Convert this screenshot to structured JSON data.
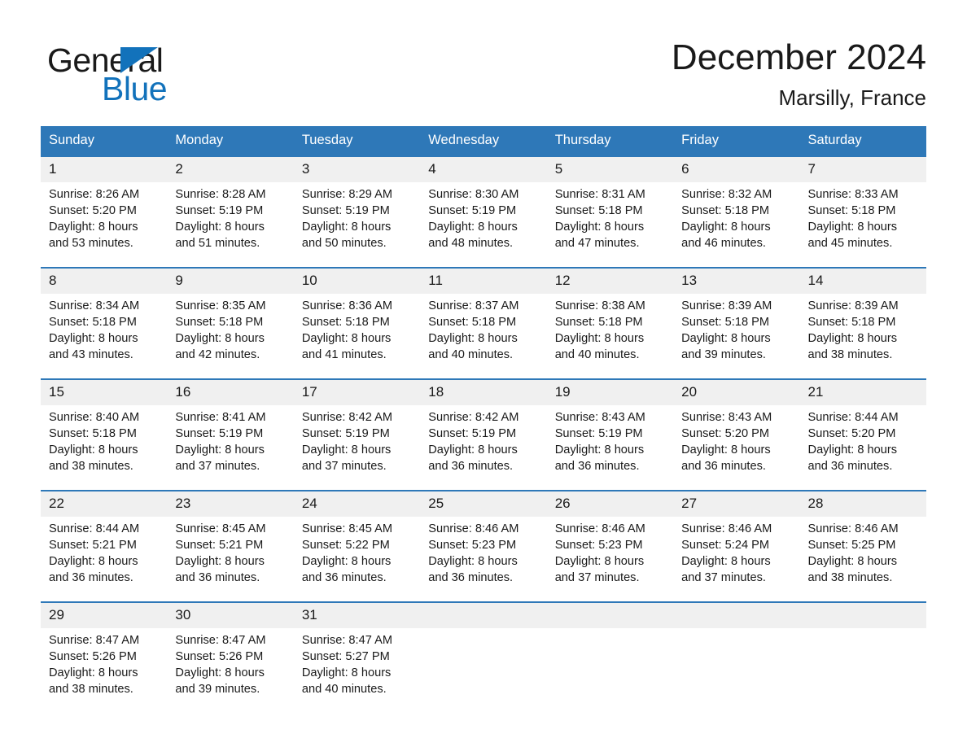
{
  "brand": {
    "name_part1": "General",
    "name_part2": "Blue",
    "triangle_color": "#1272bb",
    "logo_icon": "triangle-logo-icon"
  },
  "header": {
    "title": "December 2024",
    "location": "Marsilly, France"
  },
  "colors": {
    "header_row": "#2e78b8",
    "daynum_background": "#f0f0f0",
    "accent_rule": "#2e78b8",
    "text": "#1a1a1a"
  },
  "calendar": {
    "weekday_headers": [
      "Sunday",
      "Monday",
      "Tuesday",
      "Wednesday",
      "Thursday",
      "Friday",
      "Saturday"
    ],
    "weeks": [
      [
        {
          "day": "1",
          "sunrise": "Sunrise: 8:26 AM",
          "sunset": "Sunset: 5:20 PM",
          "daylight1": "Daylight: 8 hours",
          "daylight2": "and 53 minutes."
        },
        {
          "day": "2",
          "sunrise": "Sunrise: 8:28 AM",
          "sunset": "Sunset: 5:19 PM",
          "daylight1": "Daylight: 8 hours",
          "daylight2": "and 51 minutes."
        },
        {
          "day": "3",
          "sunrise": "Sunrise: 8:29 AM",
          "sunset": "Sunset: 5:19 PM",
          "daylight1": "Daylight: 8 hours",
          "daylight2": "and 50 minutes."
        },
        {
          "day": "4",
          "sunrise": "Sunrise: 8:30 AM",
          "sunset": "Sunset: 5:19 PM",
          "daylight1": "Daylight: 8 hours",
          "daylight2": "and 48 minutes."
        },
        {
          "day": "5",
          "sunrise": "Sunrise: 8:31 AM",
          "sunset": "Sunset: 5:18 PM",
          "daylight1": "Daylight: 8 hours",
          "daylight2": "and 47 minutes."
        },
        {
          "day": "6",
          "sunrise": "Sunrise: 8:32 AM",
          "sunset": "Sunset: 5:18 PM",
          "daylight1": "Daylight: 8 hours",
          "daylight2": "and 46 minutes."
        },
        {
          "day": "7",
          "sunrise": "Sunrise: 8:33 AM",
          "sunset": "Sunset: 5:18 PM",
          "daylight1": "Daylight: 8 hours",
          "daylight2": "and 45 minutes."
        }
      ],
      [
        {
          "day": "8",
          "sunrise": "Sunrise: 8:34 AM",
          "sunset": "Sunset: 5:18 PM",
          "daylight1": "Daylight: 8 hours",
          "daylight2": "and 43 minutes."
        },
        {
          "day": "9",
          "sunrise": "Sunrise: 8:35 AM",
          "sunset": "Sunset: 5:18 PM",
          "daylight1": "Daylight: 8 hours",
          "daylight2": "and 42 minutes."
        },
        {
          "day": "10",
          "sunrise": "Sunrise: 8:36 AM",
          "sunset": "Sunset: 5:18 PM",
          "daylight1": "Daylight: 8 hours",
          "daylight2": "and 41 minutes."
        },
        {
          "day": "11",
          "sunrise": "Sunrise: 8:37 AM",
          "sunset": "Sunset: 5:18 PM",
          "daylight1": "Daylight: 8 hours",
          "daylight2": "and 40 minutes."
        },
        {
          "day": "12",
          "sunrise": "Sunrise: 8:38 AM",
          "sunset": "Sunset: 5:18 PM",
          "daylight1": "Daylight: 8 hours",
          "daylight2": "and 40 minutes."
        },
        {
          "day": "13",
          "sunrise": "Sunrise: 8:39 AM",
          "sunset": "Sunset: 5:18 PM",
          "daylight1": "Daylight: 8 hours",
          "daylight2": "and 39 minutes."
        },
        {
          "day": "14",
          "sunrise": "Sunrise: 8:39 AM",
          "sunset": "Sunset: 5:18 PM",
          "daylight1": "Daylight: 8 hours",
          "daylight2": "and 38 minutes."
        }
      ],
      [
        {
          "day": "15",
          "sunrise": "Sunrise: 8:40 AM",
          "sunset": "Sunset: 5:18 PM",
          "daylight1": "Daylight: 8 hours",
          "daylight2": "and 38 minutes."
        },
        {
          "day": "16",
          "sunrise": "Sunrise: 8:41 AM",
          "sunset": "Sunset: 5:19 PM",
          "daylight1": "Daylight: 8 hours",
          "daylight2": "and 37 minutes."
        },
        {
          "day": "17",
          "sunrise": "Sunrise: 8:42 AM",
          "sunset": "Sunset: 5:19 PM",
          "daylight1": "Daylight: 8 hours",
          "daylight2": "and 37 minutes."
        },
        {
          "day": "18",
          "sunrise": "Sunrise: 8:42 AM",
          "sunset": "Sunset: 5:19 PM",
          "daylight1": "Daylight: 8 hours",
          "daylight2": "and 36 minutes."
        },
        {
          "day": "19",
          "sunrise": "Sunrise: 8:43 AM",
          "sunset": "Sunset: 5:19 PM",
          "daylight1": "Daylight: 8 hours",
          "daylight2": "and 36 minutes."
        },
        {
          "day": "20",
          "sunrise": "Sunrise: 8:43 AM",
          "sunset": "Sunset: 5:20 PM",
          "daylight1": "Daylight: 8 hours",
          "daylight2": "and 36 minutes."
        },
        {
          "day": "21",
          "sunrise": "Sunrise: 8:44 AM",
          "sunset": "Sunset: 5:20 PM",
          "daylight1": "Daylight: 8 hours",
          "daylight2": "and 36 minutes."
        }
      ],
      [
        {
          "day": "22",
          "sunrise": "Sunrise: 8:44 AM",
          "sunset": "Sunset: 5:21 PM",
          "daylight1": "Daylight: 8 hours",
          "daylight2": "and 36 minutes."
        },
        {
          "day": "23",
          "sunrise": "Sunrise: 8:45 AM",
          "sunset": "Sunset: 5:21 PM",
          "daylight1": "Daylight: 8 hours",
          "daylight2": "and 36 minutes."
        },
        {
          "day": "24",
          "sunrise": "Sunrise: 8:45 AM",
          "sunset": "Sunset: 5:22 PM",
          "daylight1": "Daylight: 8 hours",
          "daylight2": "and 36 minutes."
        },
        {
          "day": "25",
          "sunrise": "Sunrise: 8:46 AM",
          "sunset": "Sunset: 5:23 PM",
          "daylight1": "Daylight: 8 hours",
          "daylight2": "and 36 minutes."
        },
        {
          "day": "26",
          "sunrise": "Sunrise: 8:46 AM",
          "sunset": "Sunset: 5:23 PM",
          "daylight1": "Daylight: 8 hours",
          "daylight2": "and 37 minutes."
        },
        {
          "day": "27",
          "sunrise": "Sunrise: 8:46 AM",
          "sunset": "Sunset: 5:24 PM",
          "daylight1": "Daylight: 8 hours",
          "daylight2": "and 37 minutes."
        },
        {
          "day": "28",
          "sunrise": "Sunrise: 8:46 AM",
          "sunset": "Sunset: 5:25 PM",
          "daylight1": "Daylight: 8 hours",
          "daylight2": "and 38 minutes."
        }
      ],
      [
        {
          "day": "29",
          "sunrise": "Sunrise: 8:47 AM",
          "sunset": "Sunset: 5:26 PM",
          "daylight1": "Daylight: 8 hours",
          "daylight2": "and 38 minutes."
        },
        {
          "day": "30",
          "sunrise": "Sunrise: 8:47 AM",
          "sunset": "Sunset: 5:26 PM",
          "daylight1": "Daylight: 8 hours",
          "daylight2": "and 39 minutes."
        },
        {
          "day": "31",
          "sunrise": "Sunrise: 8:47 AM",
          "sunset": "Sunset: 5:27 PM",
          "daylight1": "Daylight: 8 hours",
          "daylight2": "and 40 minutes."
        },
        {
          "day": "",
          "sunrise": "",
          "sunset": "",
          "daylight1": "",
          "daylight2": ""
        },
        {
          "day": "",
          "sunrise": "",
          "sunset": "",
          "daylight1": "",
          "daylight2": ""
        },
        {
          "day": "",
          "sunrise": "",
          "sunset": "",
          "daylight1": "",
          "daylight2": ""
        },
        {
          "day": "",
          "sunrise": "",
          "sunset": "",
          "daylight1": "",
          "daylight2": ""
        }
      ]
    ]
  }
}
